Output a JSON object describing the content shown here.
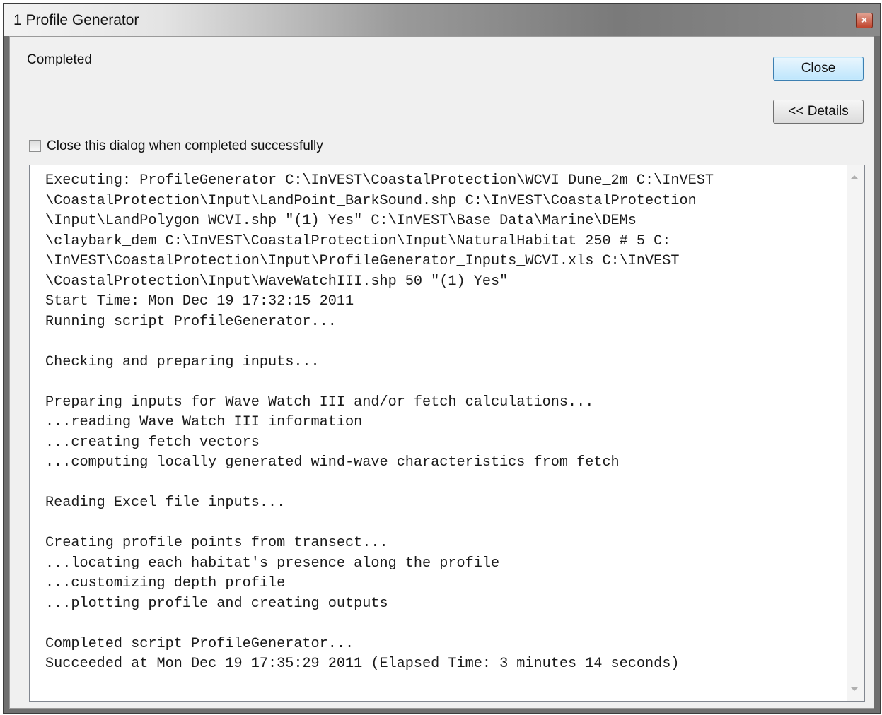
{
  "window": {
    "title": "1 Profile Generator",
    "close_glyph": "×"
  },
  "status_text": "Completed",
  "buttons": {
    "close_label": "Close",
    "details_label": "<< Details"
  },
  "checkbox": {
    "label": "Close this dialog when completed successfully",
    "checked": false
  },
  "log": {
    "lines": [
      "Executing: ProfileGenerator C:\\InVEST\\CoastalProtection\\WCVI Dune_2m C:\\InVEST",
      "\\CoastalProtection\\Input\\LandPoint_BarkSound.shp C:\\InVEST\\CoastalProtection",
      "\\Input\\LandPolygon_WCVI.shp \"(1) Yes\" C:\\InVEST\\Base_Data\\Marine\\DEMs",
      "\\claybark_dem C:\\InVEST\\CoastalProtection\\Input\\NaturalHabitat 250 # 5 C:",
      "\\InVEST\\CoastalProtection\\Input\\ProfileGenerator_Inputs_WCVI.xls C:\\InVEST",
      "\\CoastalProtection\\Input\\WaveWatchIII.shp 50 \"(1) Yes\"",
      "Start Time: Mon Dec 19 17:32:15 2011",
      "Running script ProfileGenerator...",
      "",
      "Checking and preparing inputs...",
      "",
      "Preparing inputs for Wave Watch III and/or fetch calculations...",
      "...reading Wave Watch III information",
      "...creating fetch vectors",
      "...computing locally generated wind-wave characteristics from fetch",
      "",
      "Reading Excel file inputs...",
      "",
      "Creating profile points from transect...",
      "...locating each habitat's presence along the profile",
      "...customizing depth profile",
      "...plotting profile and creating outputs",
      "",
      "Completed script ProfileGenerator...",
      "Succeeded at Mon Dec 19 17:35:29 2011 (Elapsed Time: 3 minutes 14 seconds)"
    ]
  },
  "colors": {
    "close_button_border": "#3c7fb1",
    "title_close_red": "#c0452e"
  }
}
